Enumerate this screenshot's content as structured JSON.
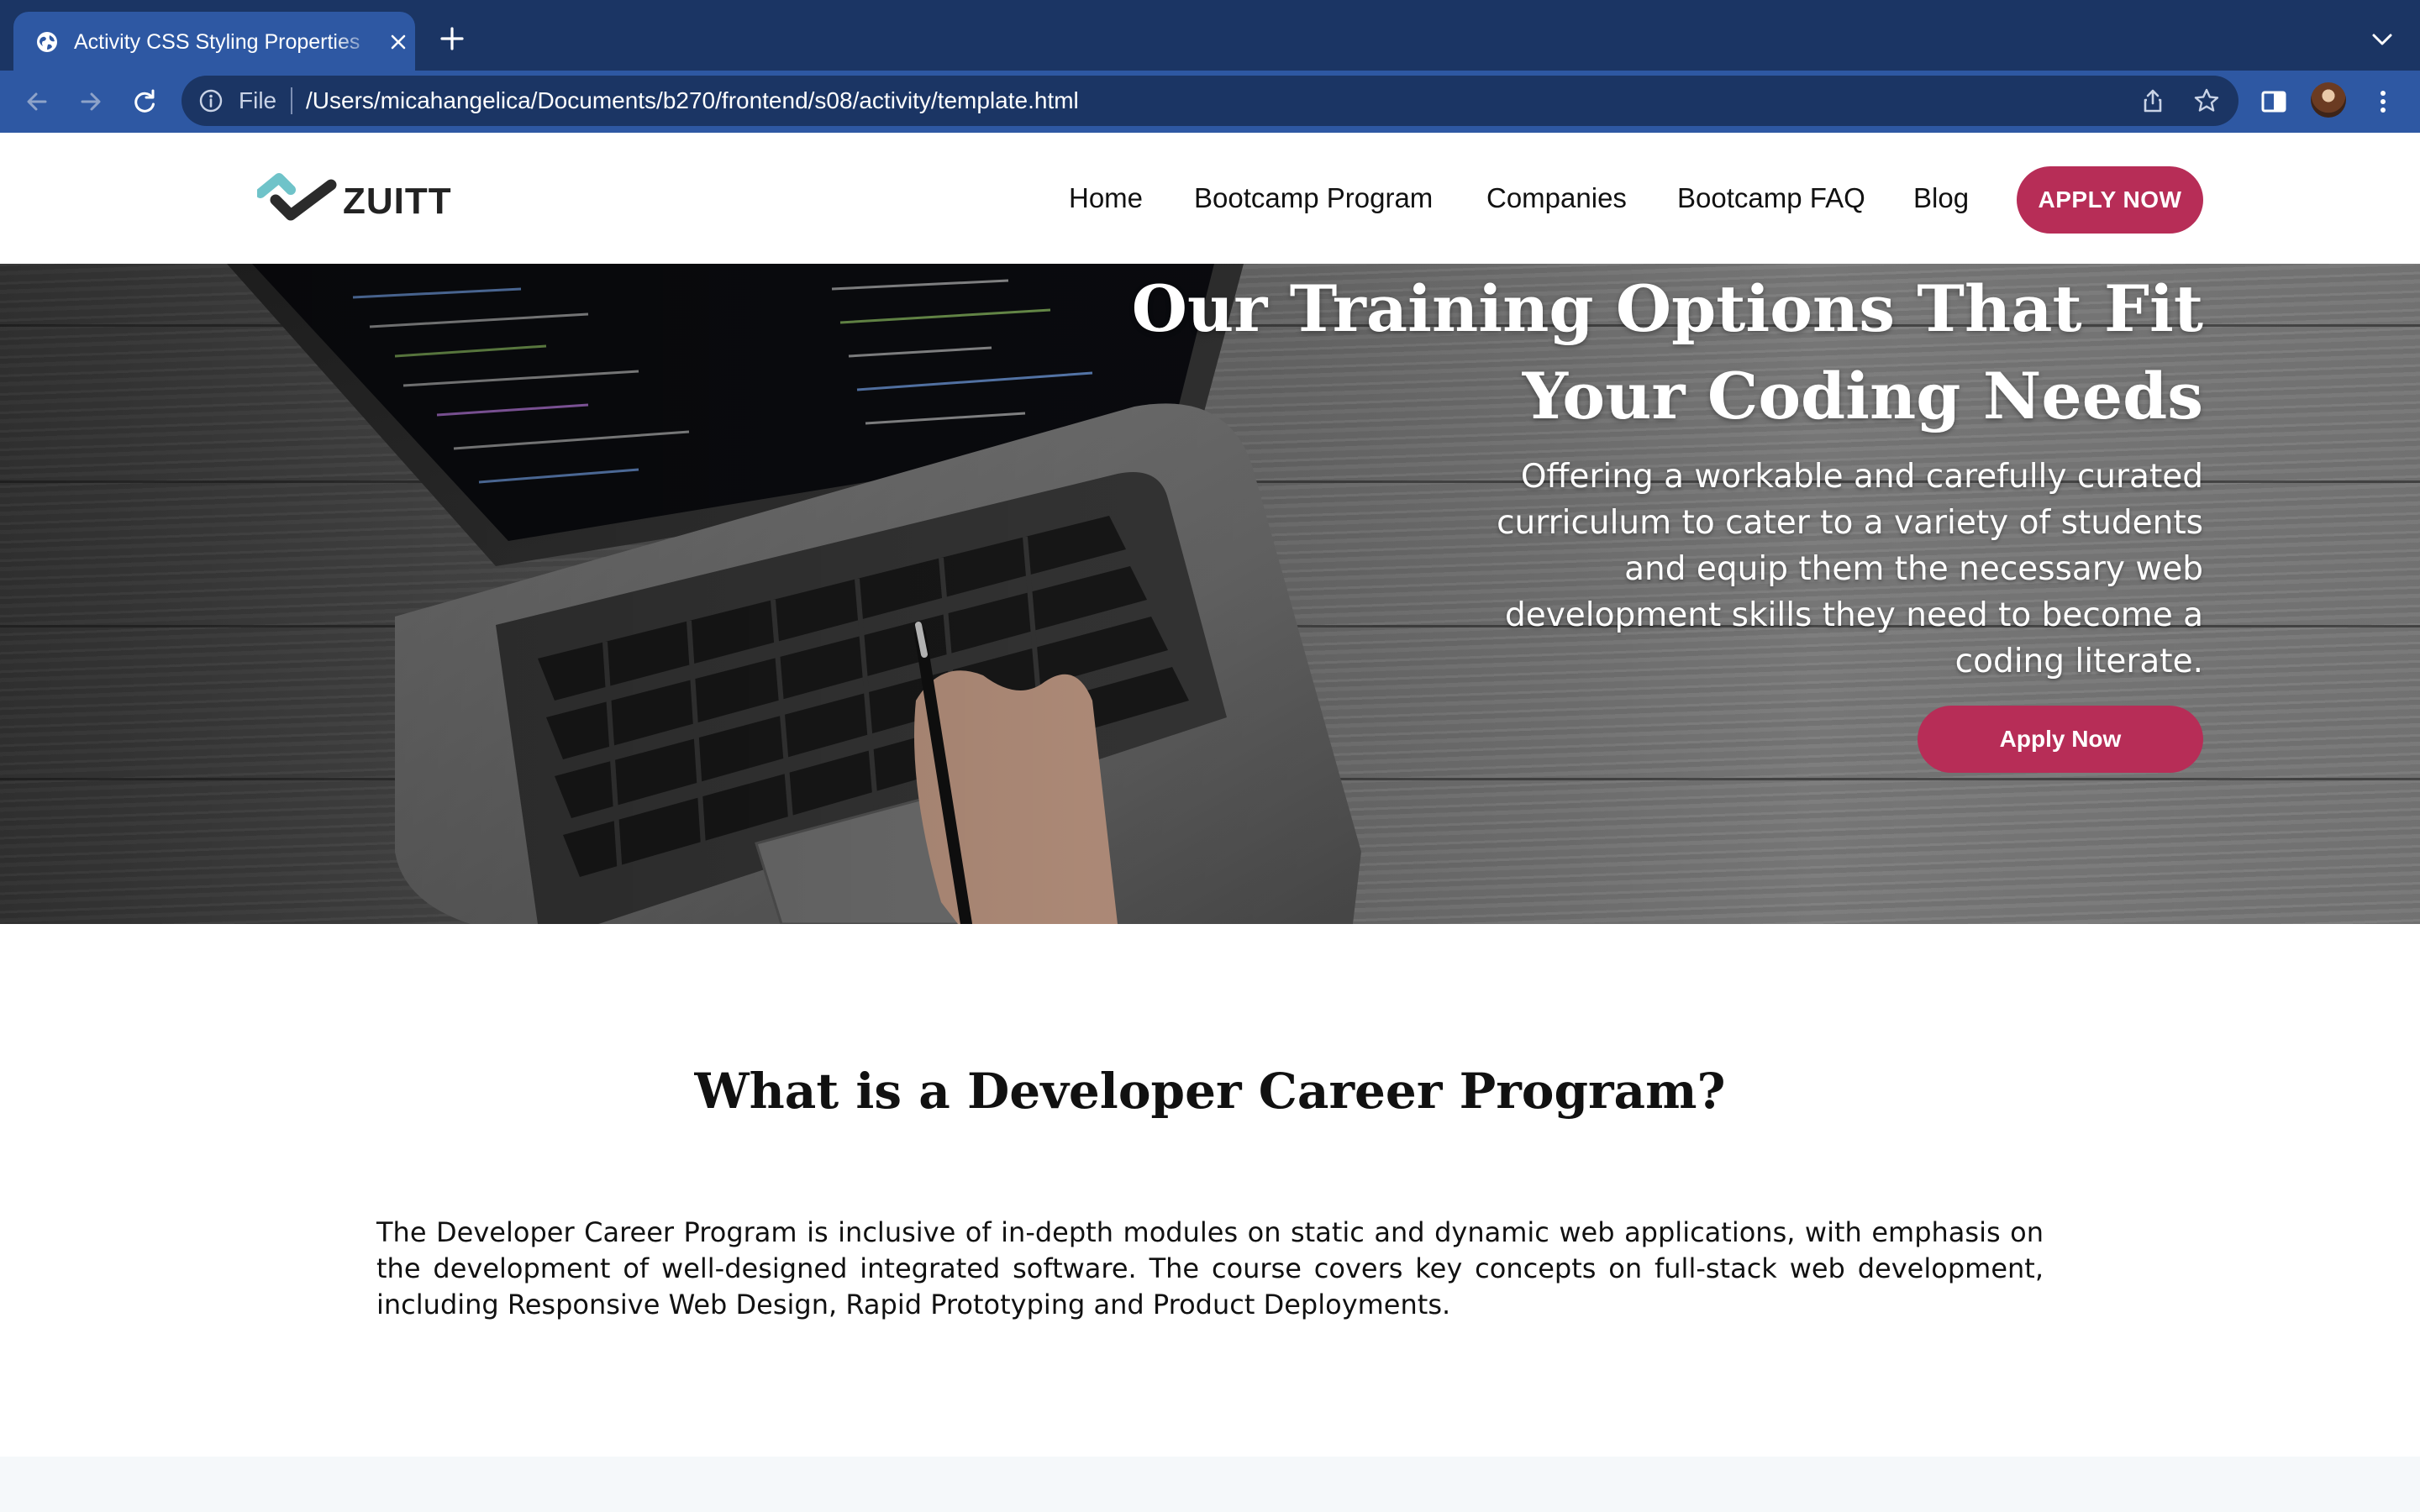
{
  "browser": {
    "tab_title": "Activity CSS Styling Properties",
    "address_scheme": "File",
    "address_url": "/Users/micahangelica/Documents/b270/frontend/s08/activity/template.html"
  },
  "site": {
    "logo_text": "ZUITT",
    "nav": [
      {
        "label": "Home"
      },
      {
        "label": "Bootcamp Program"
      },
      {
        "label": "Companies"
      },
      {
        "label": "Bootcamp FAQ"
      },
      {
        "label": "Blog"
      }
    ],
    "apply_button": "APPLY NOW",
    "brand_color": "#b72d57"
  },
  "hero": {
    "title_line1": "Our Training Options That Fit",
    "title_line2": "Your Coding Needs",
    "subtitle_line1": "Offering a workable and carefully curated",
    "subtitle_line2": "curriculum to cater to a variety of students",
    "subtitle_line3": "and equip them the necessary web",
    "subtitle_line4": "development skills they need to become a",
    "subtitle_line5": "coding literate.",
    "button": "Apply Now"
  },
  "program": {
    "title": "What is a Developer Career Program?",
    "text": "The Developer Career Program is inclusive of in-depth modules on static and dynamic web applications, with emphasis on the development of well-designed integrated software. The course covers key concepts on full-stack web development, including Responsive Web Design, Rapid Prototyping and Product Deployments."
  },
  "icons": {
    "tab_favicon": "globe-icon",
    "tab_close": "close-icon",
    "new_tab": "plus-icon",
    "back": "arrow-left-icon",
    "forward": "arrow-right-icon",
    "reload": "reload-icon",
    "info": "info-icon",
    "share": "share-icon",
    "bookmark": "star-icon",
    "side_panel": "side-panel-icon",
    "menu": "kebab-menu-icon"
  }
}
